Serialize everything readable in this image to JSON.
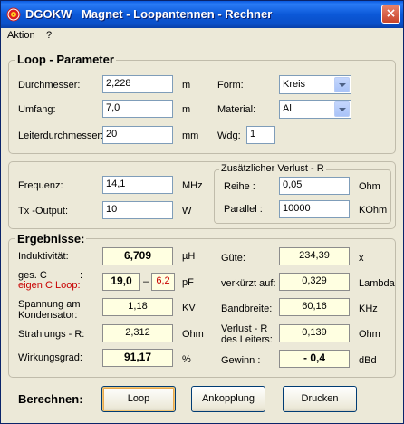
{
  "window": {
    "title": "DGOKW   Magnet - Loopantennen - Rechner",
    "close_label": "×",
    "accent_color": "#0b58d8"
  },
  "menu": {
    "items": [
      "Aktion",
      "?"
    ]
  },
  "loop_parameter": {
    "title": "Loop - Parameter",
    "durchmesser": {
      "label": "Durchmesser:",
      "value": "2,228",
      "unit": "m"
    },
    "umfang": {
      "label": "Umfang:",
      "value": "7,0",
      "unit": "m"
    },
    "leiterdurchmesser": {
      "label": "Leiterdurchmesser:",
      "value": "20",
      "unit": "mm"
    },
    "form": {
      "label": "Form:",
      "value": "Kreis"
    },
    "material": {
      "label": "Material:",
      "value": "Al"
    },
    "wdg": {
      "label": "Wdg:",
      "value": "1"
    },
    "frequenz": {
      "label": "Frequenz:",
      "value": "14,1",
      "unit": "MHz"
    },
    "tx_output": {
      "label": "Tx -Output:",
      "value": "10",
      "unit": "W"
    }
  },
  "verlust": {
    "title": "Zusätzlicher Verlust - R",
    "reihe": {
      "label": "Reihe :",
      "value": "0,05",
      "unit": "Ohm"
    },
    "parallel": {
      "label": "Parallel :",
      "value": "10000",
      "unit": "KOhm"
    }
  },
  "ergebnisse": {
    "title": "Ergebnisse:",
    "induktivitaet": {
      "label": "Induktivität:",
      "value": "6,709",
      "unit": "µH"
    },
    "kapazitaet": {
      "label_1": "ges.  C",
      "label_2": "eigen C  Loop:",
      "colon": ":",
      "value": "19,0",
      "dash": "–",
      "eigen_value": "6,2",
      "unit": "pF"
    },
    "spannung": {
      "label_1": "Spannung am",
      "label_2": "Kondensator:",
      "value": "1,18",
      "unit": "KV"
    },
    "strahlungs": {
      "label": "Strahlungs - R:",
      "value": "2,312",
      "unit": "Ohm"
    },
    "wirkungsgrad": {
      "label": "Wirkungsgrad:",
      "value": "91,17",
      "unit": "%"
    },
    "guete": {
      "label": "Güte:",
      "value": "234,39",
      "unit": "x"
    },
    "verkuerzt": {
      "label": "verkürzt auf:",
      "value": "0,329",
      "unit": "Lambda"
    },
    "bandbreite": {
      "label": "Bandbreite:",
      "value": "60,16",
      "unit": "KHz"
    },
    "verlust_leiter": {
      "label_1": "Verlust - R",
      "label_2": "des Leiters:",
      "value": "0,139",
      "unit": "Ohm"
    },
    "gewinn": {
      "label": "Gewinn :",
      "value": "- 0,4",
      "unit": "dBd"
    }
  },
  "berechnen": {
    "label": "Berechnen:",
    "loop_button": "Loop",
    "ankopplung_button": "Ankopplung",
    "drucken_button": "Drucken"
  }
}
